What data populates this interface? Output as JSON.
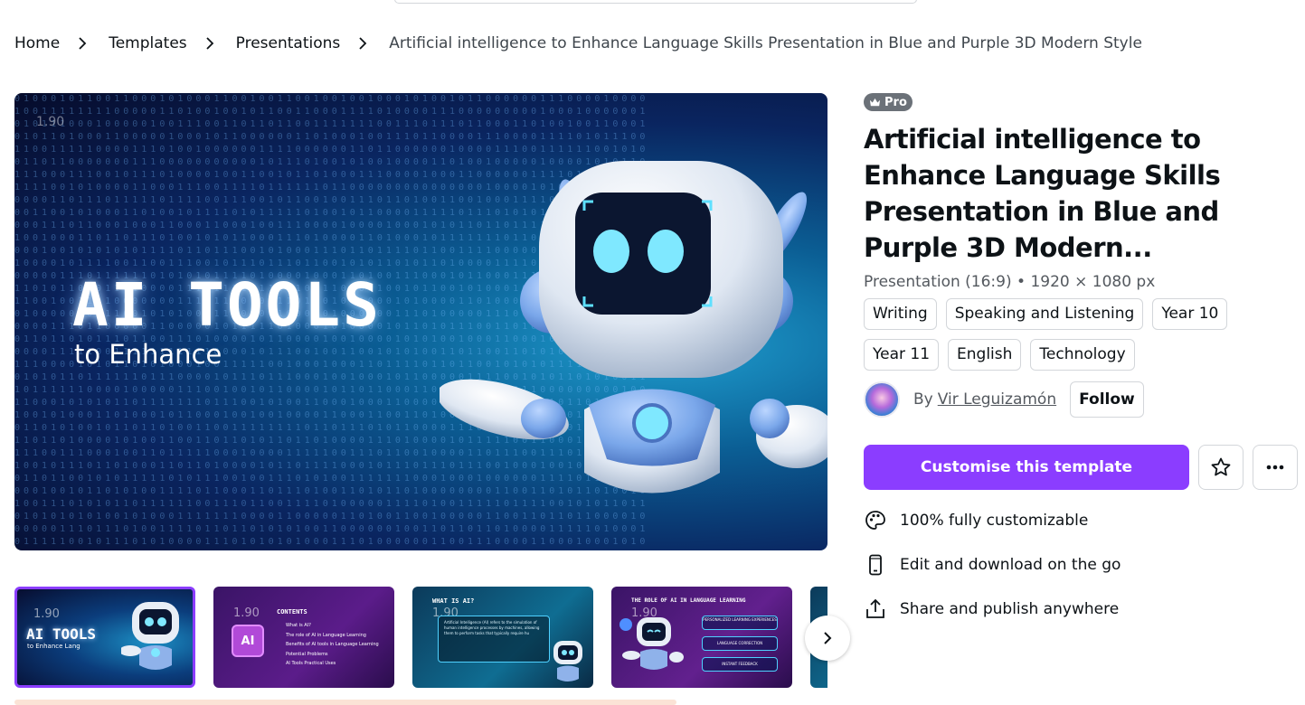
{
  "breadcrumb": {
    "items": [
      {
        "label": "Home"
      },
      {
        "label": "Templates"
      },
      {
        "label": "Presentations"
      },
      {
        "label": "Artificial intelligence to Enhance Language Skills Presentation in Blue and Purple 3D Modern Style"
      }
    ]
  },
  "hero": {
    "version": "1.90",
    "headline": "AI TOOLS",
    "subline": "to Enhance"
  },
  "thumbnails": [
    {
      "version": "1.90",
      "title": "AI TOOLS",
      "subtitle": "to Enhance Lang",
      "selected": true
    },
    {
      "version": "1.90",
      "title": "CONTENTS",
      "badge": "AI",
      "items": [
        "What is AI?",
        "The role of AI in Language Learning",
        "Benefits of AI tools in Language Learning",
        "Potential Problems",
        "AI Tools Practical Uses"
      ]
    },
    {
      "version": "1.90",
      "title": "WHAT IS AI?",
      "body": "Artificial Intelligence (AI) refers to the simulation of human intelligence processes by machines, allowing them to perform tasks that typically require hu"
    },
    {
      "version": "1.90",
      "title": "THE ROLE OF AI IN LANGUAGE LEARNING",
      "items": [
        "PERSONALIZED LEARNING EXPERIENCES",
        "LANGUAGE CORRECTION",
        "INSTANT FEEDBACK"
      ]
    }
  ],
  "details": {
    "badge": "Pro",
    "title": "Artificial intelligence to Enhance Language Skills Presentation in Blue and Purple 3D Modern...",
    "meta": "Presentation (16:9) • 1920 × 1080 px",
    "tags": [
      "Writing",
      "Speaking and Listening",
      "Year 10",
      "Year 11",
      "English",
      "Technology"
    ],
    "author_prefix": "By",
    "author_name": "Vir Leguizamón",
    "follow_label": "Follow",
    "cta_label": "Customise this template",
    "features": [
      {
        "icon": "palette-icon",
        "label": "100% fully customizable"
      },
      {
        "icon": "mobile-icon",
        "label": "Edit and download on the go"
      },
      {
        "icon": "share-icon",
        "label": "Share and publish anywhere"
      }
    ]
  },
  "colors": {
    "accent": "#8b3dff",
    "pro_badge": "#6b7178",
    "text": "#0d1216",
    "muted": "#54595f"
  }
}
